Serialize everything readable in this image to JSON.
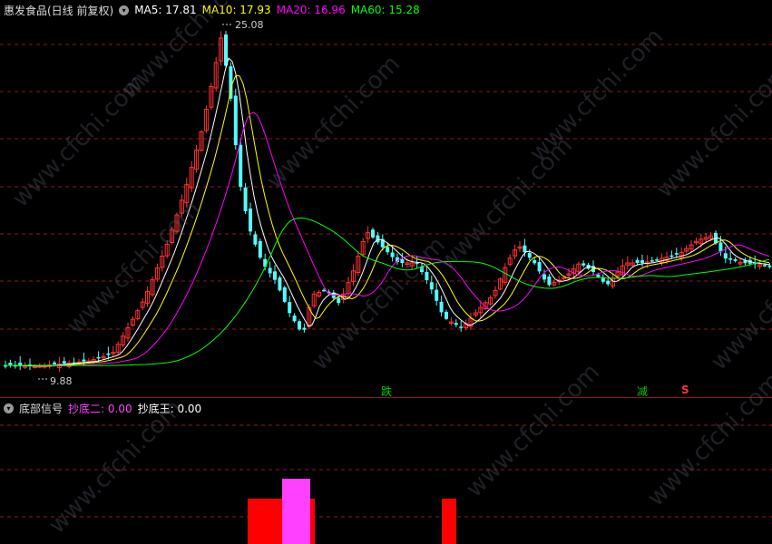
{
  "main": {
    "stock_name": "惠发食品(日线 前复权)",
    "ma5_label": "MA5: 17.81",
    "ma10_label": "MA10: 17.93",
    "ma20_label": "MA20: 16.96",
    "ma60_label": "MA60: 15.28",
    "high_label": "25.08",
    "low_label": "9.88",
    "marker_1": "跌",
    "marker_2": "减",
    "marker_3": "S"
  },
  "signal": {
    "title": "底部信号",
    "line1_label": "抄底二: 0.00",
    "line2_label": "抄底王: 0.00"
  },
  "watermark": "www.cfchi.com",
  "colors": {
    "up": "#ff3232",
    "down": "#54fcfc",
    "ma5": "#ffffff",
    "ma10": "#ffff00",
    "ma20": "#ff00ff",
    "ma60": "#00ff00",
    "grid": "#8b1a1a"
  }
}
